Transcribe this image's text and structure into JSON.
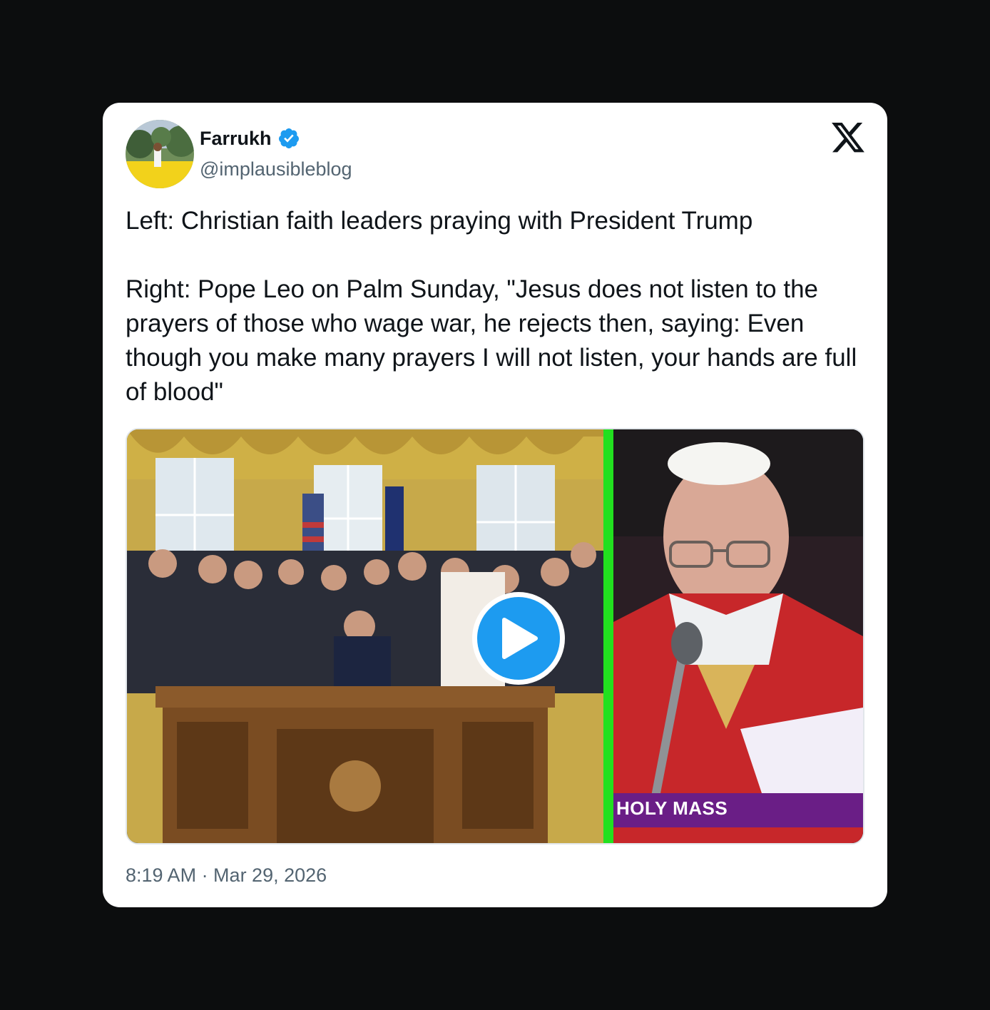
{
  "author": {
    "name": "Farrukh",
    "handle": "@implausibleblog",
    "verified": true
  },
  "tweet": {
    "text": "Left: Christian faith leaders praying with President Trump\n\nRight: Pope Leo on Palm Sunday, \"Jesus does not listen to the prayers of those who wage war, he rejects then, saying: Even though you make many prayers I will not listen, your hands are full of blood\"",
    "timestamp": "8:19 AM · Mar 29, 2026"
  },
  "media": {
    "type": "video",
    "caption_overlay": "HOLY MASS"
  },
  "icons": {
    "brand": "x-logo-icon",
    "verified": "verified-badge-icon",
    "play": "play-icon"
  },
  "colors": {
    "verified_blue": "#1d9bf0",
    "text_primary": "#0f1419",
    "text_secondary": "#536471",
    "divider_green": "#22e01f",
    "caption_purple": "#6a1e86",
    "background": "#0c0d0e"
  }
}
